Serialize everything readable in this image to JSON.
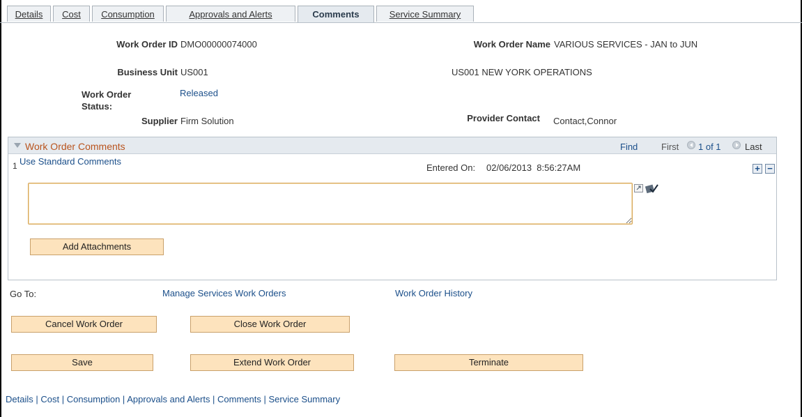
{
  "tabs": [
    {
      "label": "Details"
    },
    {
      "label": "Cost"
    },
    {
      "label": "Consumption"
    },
    {
      "label": "Approvals and Alerts"
    },
    {
      "label": "Comments"
    },
    {
      "label": "Service Summary"
    }
  ],
  "header": {
    "work_order_id_label": "Work Order ID",
    "work_order_id": "DMO00000074000",
    "work_order_name_label": "Work Order Name",
    "work_order_name": "VARIOUS SERVICES - JAN to JUN",
    "business_unit_label": "Business Unit",
    "business_unit": "US001",
    "business_unit_desc": "US001 NEW YORK OPERATIONS",
    "status_label_1": "Work Order",
    "status_label_2": "Status:",
    "status": "Released",
    "supplier_label": "Supplier",
    "supplier": "Firm Solution",
    "provider_contact_label": "Provider Contact",
    "provider_contact": "Contact,Connor"
  },
  "comments_grid": {
    "title": "Work Order Comments",
    "find": "Find",
    "first": "First",
    "count": "1 of 1",
    "last": "Last",
    "row_number": "1",
    "use_standard_comments": "Use Standard Comments",
    "entered_on_label": "Entered On:",
    "entered_on": "02/06/2013  8:56:27AM",
    "comment_text": "",
    "add_attachments": "Add Attachments",
    "add_row": "+",
    "delete_row": "−"
  },
  "goto": {
    "label": "Go To:",
    "manage_link": "Manage Services Work Orders",
    "history_link": "Work Order History"
  },
  "buttons": {
    "cancel": "Cancel Work Order",
    "close": "Close Work Order",
    "save": "Save",
    "extend": "Extend Work Order",
    "terminate": "Terminate"
  },
  "footer_links": {
    "details": "Details",
    "cost": "Cost",
    "consumption": "Consumption",
    "approvals": "Approvals and Alerts",
    "comments": "Comments",
    "service_summary": "Service Summary",
    "separator": " | "
  }
}
